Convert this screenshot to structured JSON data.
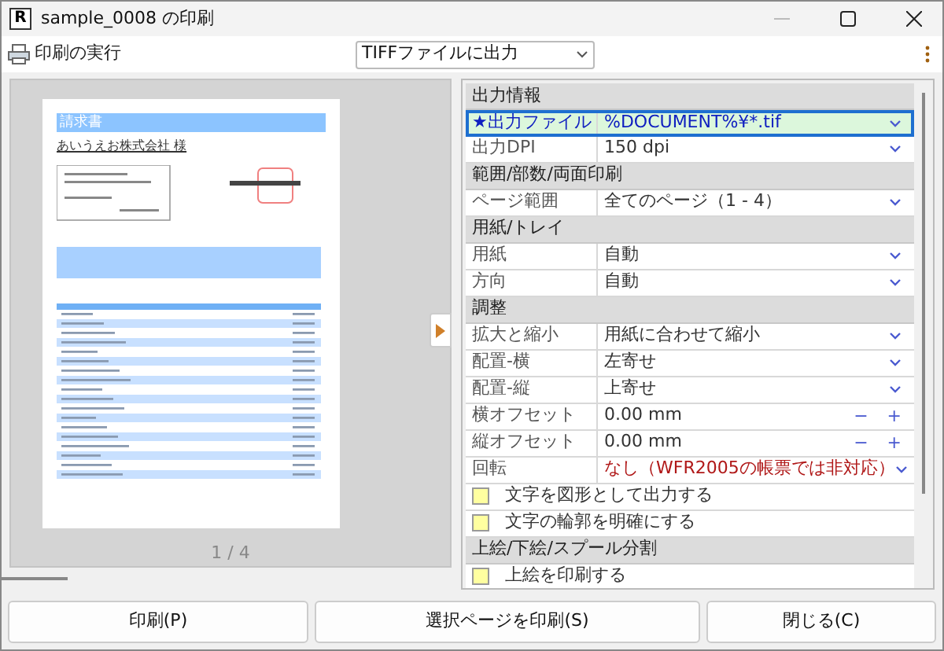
{
  "window": {
    "title": "sample_0008 の印刷",
    "app_icon": "R"
  },
  "toolbar": {
    "print_label": "印刷の実行",
    "output_select": "TIFFファイルに出力"
  },
  "preview": {
    "document_title": "請求書",
    "addressee": "あいうえお株式会社 様",
    "page_indicator": "1 / 4"
  },
  "properties": [
    {
      "kind": "header",
      "label": "出力情報"
    },
    {
      "kind": "select",
      "label": "★出力ファイル",
      "value": "%DOCUMENT%¥*.tif",
      "selected": true,
      "warning": false
    },
    {
      "kind": "select",
      "label": "出力DPI",
      "value": "150 dpi",
      "selected": false,
      "warning": false
    },
    {
      "kind": "header",
      "label": "範囲/部数/両面印刷"
    },
    {
      "kind": "select",
      "label": "ページ範囲",
      "value": "全てのページ（1 - 4）",
      "selected": false,
      "warning": false
    },
    {
      "kind": "header",
      "label": "用紙/トレイ"
    },
    {
      "kind": "select",
      "label": "用紙",
      "value": "自動",
      "selected": false,
      "warning": false
    },
    {
      "kind": "select",
      "label": "方向",
      "value": "自動",
      "selected": false,
      "warning": false
    },
    {
      "kind": "header",
      "label": "調整"
    },
    {
      "kind": "select",
      "label": "拡大と縮小",
      "value": "用紙に合わせて縮小",
      "selected": false,
      "warning": false
    },
    {
      "kind": "select",
      "label": "配置-横",
      "value": "左寄せ",
      "selected": false,
      "warning": false
    },
    {
      "kind": "select",
      "label": "配置-縦",
      "value": "上寄せ",
      "selected": false,
      "warning": false
    },
    {
      "kind": "offset",
      "label": "横オフセット",
      "value": "0.00 mm",
      "minus": "−",
      "plus": "+",
      "selected": false
    },
    {
      "kind": "offset",
      "label": "縦オフセット",
      "value": "0.00 mm",
      "minus": "−",
      "plus": "+",
      "selected": false
    },
    {
      "kind": "select",
      "label": "回転",
      "value": "なし（WFR2005の帳票では非対応）",
      "selected": false,
      "warning": true
    },
    {
      "kind": "checkbox",
      "label": "文字を図形として出力する",
      "checked": false
    },
    {
      "kind": "checkbox",
      "label": "文字の輪郭を明確にする",
      "checked": false
    },
    {
      "kind": "header",
      "label": "上絵/下絵/スプール分割"
    },
    {
      "kind": "checkbox",
      "label": "上絵を印刷する",
      "checked": false
    }
  ],
  "buttons": [
    "印刷(P)",
    "選択ページを印刷(S)",
    "閉じる(C)"
  ]
}
